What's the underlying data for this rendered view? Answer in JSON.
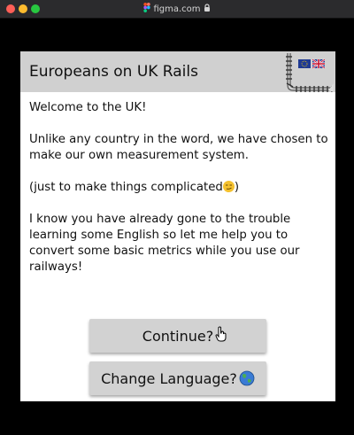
{
  "window": {
    "title": "figma.com",
    "icons": [
      "figma-icon",
      "lock-icon"
    ]
  },
  "header": {
    "title": "Europeans on UK Rails",
    "illustration": [
      "eu-flag-icon",
      "uk-flag-icon",
      "railway-track-icon"
    ]
  },
  "body": {
    "welcome": "Welcome to the UK!",
    "para1": "Unlike any country in the word, we have chosen to make our own measurement system.",
    "para2": "(just to make things complicated",
    "para2_end": ")",
    "para2_emoji": "smirking-face-icon",
    "para3": "I know you have already gone to the trouble learning some English so let me help you to convert some basic metrics while you use our railways!"
  },
  "buttons": {
    "continue": "Continue?",
    "change_language": "Change Language?",
    "change_language_icon": "globe-icon"
  },
  "colors": {
    "header_bg": "#d0d0d0",
    "button_bg": "#d2d2d2",
    "page_bg": "#000000",
    "panel_bg": "#ffffff"
  }
}
